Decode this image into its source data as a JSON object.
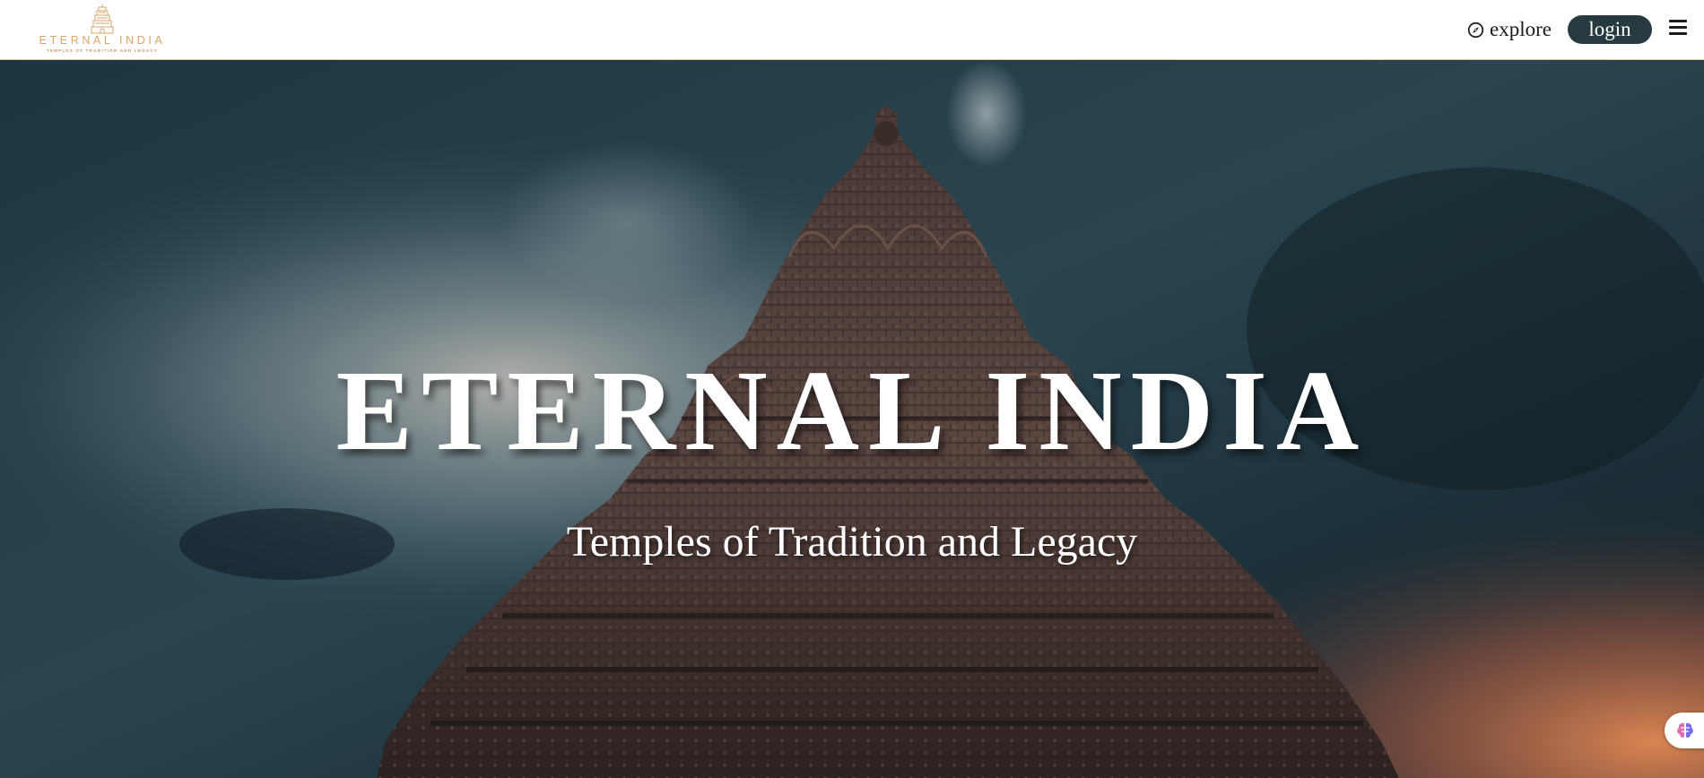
{
  "brand": {
    "logo_title": "ETERNAL INDIA",
    "logo_tagline": "TEMPLES OF TRADITION AND LEGACY",
    "accent_color": "#d9a46a"
  },
  "nav": {
    "explore_label": "explore",
    "explore_icon": "compass-icon",
    "login_label": "login",
    "menu_icon": "hamburger-menu-icon"
  },
  "hero": {
    "title": "ETERNAL INDIA",
    "subtitle": "Temples of Tradition and Legacy",
    "background": "temple-under-stormy-sky-photo"
  },
  "floating_widget": {
    "icon": "brain-icon"
  }
}
